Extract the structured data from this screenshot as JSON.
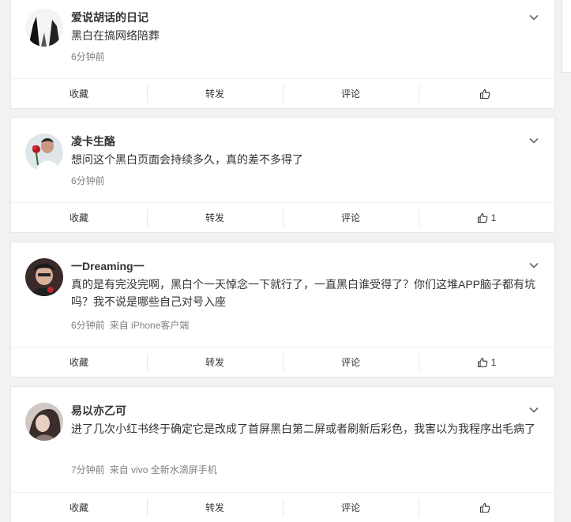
{
  "ui": {
    "colors": {
      "background": "#f2f2f2",
      "card": "#ffffff",
      "border": "#e6e6e6",
      "meta": "#808080",
      "text": "#333333"
    },
    "icons": {
      "more": "chevron-down-icon",
      "like": "thumbs-up-icon"
    }
  },
  "comments": [
    {
      "username": "爱说胡话的日记",
      "text": "黑白在搞网络陪葬",
      "time": "6分钟前",
      "source": "",
      "actions": {
        "favorite": "收藏",
        "repost": "转发",
        "comment": "评论",
        "likes": ""
      }
    },
    {
      "username": "凌卡生酪",
      "text": "想问这个黑白页面会持续多久，真的差不多得了",
      "time": "6分钟前",
      "source": "",
      "actions": {
        "favorite": "收藏",
        "repost": "转发",
        "comment": "评论",
        "likes": "1"
      }
    },
    {
      "username": "一Dreaming一",
      "text": "真的是有完没完啊，黑白个一天悼念一下就行了，一直黑白谁受得了？你们这堆APP脑子都有坑吗？我不说是哪些自己对号入座",
      "time": "6分钟前",
      "source": "来自 iPhone客户端",
      "actions": {
        "favorite": "收藏",
        "repost": "转发",
        "comment": "评论",
        "likes": "1"
      }
    },
    {
      "username": "易以亦乙可",
      "text": "进了几次小红书终于确定它是改成了首屏黑白第二屏或者刷新后彩色，我害以为我程序出毛病了",
      "time": "7分钟前",
      "source": "来自 vivo 全新水滴屏手机",
      "actions": {
        "favorite": "收藏",
        "repost": "转发",
        "comment": "评论",
        "likes": ""
      }
    }
  ]
}
